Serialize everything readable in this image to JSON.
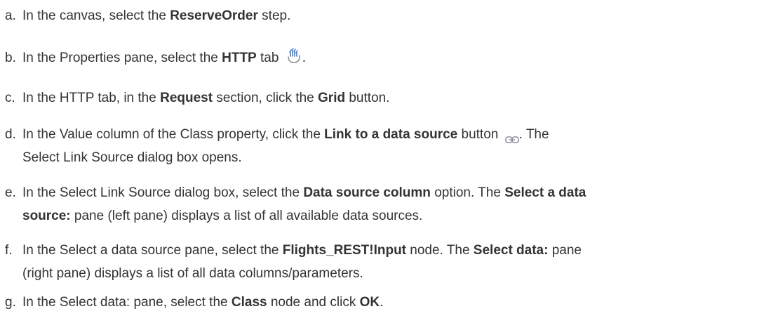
{
  "steps": [
    {
      "marker": "a.",
      "parts": [
        "In the canvas, select the ",
        "ReserveOrder",
        " step."
      ]
    },
    {
      "marker": "b.",
      "parts": [
        "In the Properties pane, select the ",
        "HTTP",
        " tab ",
        "."
      ],
      "icon": "http-tab-icon"
    },
    {
      "marker": "c.",
      "parts": [
        "In the HTTP tab, in the ",
        "Request",
        " section, click the ",
        "Grid",
        " button."
      ]
    },
    {
      "marker": "d.",
      "parts": [
        "In the Value column of the Class property, click the ",
        "Link to a data source",
        " button ",
        ". The"
      ],
      "line2": "Select Link Source dialog box opens.",
      "icon": "link-icon"
    },
    {
      "marker": "e.",
      "parts": [
        "In the Select Link Source dialog box, select the ",
        "Data source column",
        " option. The ",
        "Select a data"
      ],
      "line2_bold": "source:",
      "line2": " pane (left pane) displays a list of all available data sources."
    },
    {
      "marker": "f.",
      "parts": [
        "In the Select a data source pane, select the ",
        "Flights_REST!Input",
        " node. The ",
        "Select data:",
        " pane"
      ],
      "line2": "(right pane) displays a list of all data columns/parameters."
    },
    {
      "marker": "g.",
      "parts": [
        "In the Select data: pane, select the ",
        "Class",
        " node and click ",
        "OK",
        "."
      ]
    }
  ],
  "colors": {
    "text": "#333333",
    "icon_blue": "#3a7bd5",
    "icon_gray": "#8a8f99"
  }
}
